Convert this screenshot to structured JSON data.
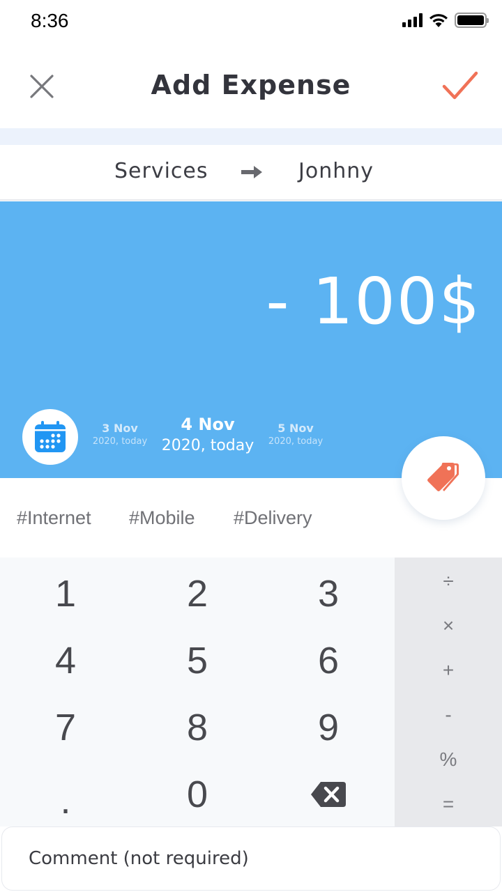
{
  "status_bar": {
    "time": "8:36",
    "icons": [
      "signal-icon",
      "wifi-icon",
      "battery-icon"
    ]
  },
  "header": {
    "title": "Add Expense",
    "close_icon": "close-icon",
    "confirm_icon": "checkmark-icon"
  },
  "transfer": {
    "from": "Services",
    "arrow_icon": "arrow-right-icon",
    "to": "Jonhny"
  },
  "amount": {
    "display": "- 100$"
  },
  "dates": {
    "calendar_icon": "calendar-icon",
    "previous": {
      "day": "3 Nov",
      "year": "2020, today"
    },
    "current": {
      "day": "4 Nov",
      "year": "2020, today"
    },
    "next": {
      "day": "5 Nov",
      "year": "2020, today"
    }
  },
  "tag_button_icon": "tags-icon",
  "tags": [
    "#Internet",
    "#Mobile",
    "#Delivery"
  ],
  "keypad": {
    "keys": [
      "1",
      "2",
      "3",
      "4",
      "5",
      "6",
      "7",
      "8",
      "9",
      ".",
      "0"
    ],
    "backspace_icon": "backspace-icon"
  },
  "operators": [
    "÷",
    "×",
    "+",
    "-",
    "%",
    "="
  ],
  "comment": {
    "placeholder": "Comment (not required)",
    "value": ""
  },
  "colors": {
    "accent": "#f07257",
    "panel_blue": "#5cb3f2",
    "calendar_blue": "#2196f3",
    "title_text": "#33343c"
  }
}
